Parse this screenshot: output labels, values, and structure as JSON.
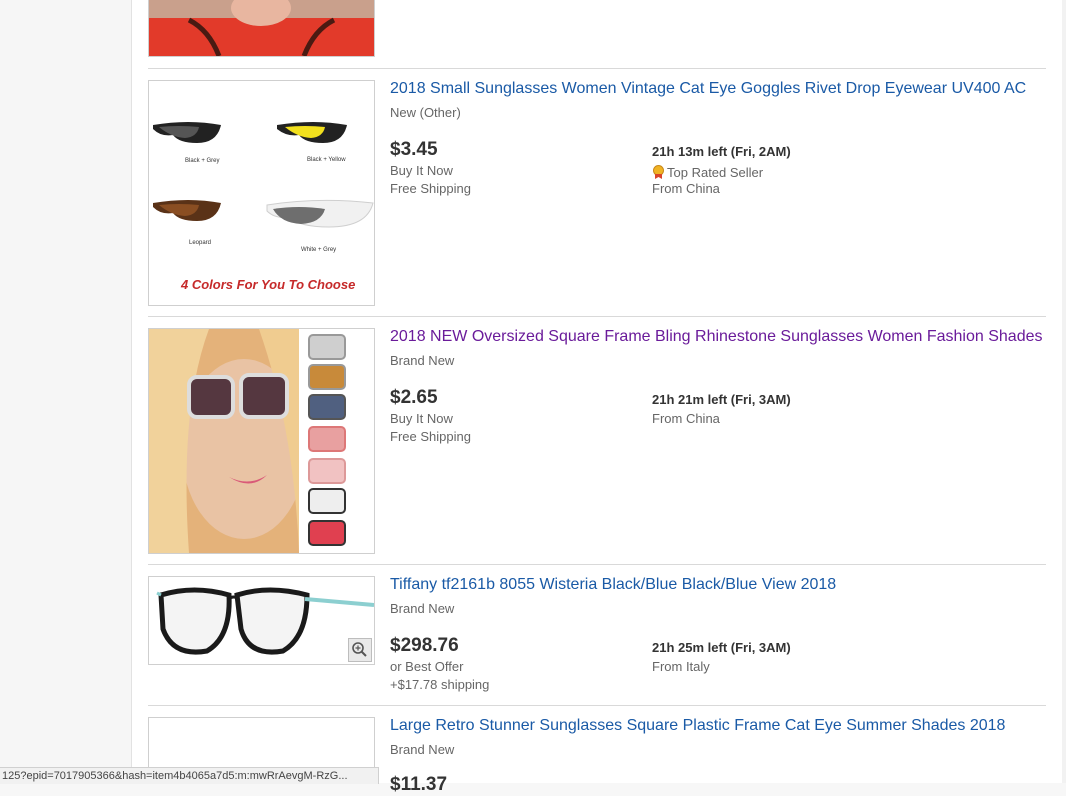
{
  "listings": [
    {
      "title": "2018 Small Sunglasses Women Vintage Cat Eye Goggles Rivet Drop Eyewear UV400 AC",
      "condition": "New (Other)",
      "price": "$3.45",
      "buy_format": "Buy It Now",
      "shipping": "Free Shipping",
      "time_left": "21h 13m left (Fri, 2AM)",
      "badge": "Top Rated Seller",
      "location": "From China",
      "image_labels": [
        "Black + Grey",
        "Black + Yellow",
        "Leopard",
        "White + Grey"
      ],
      "image_caption": "4 Colors For You To Choose"
    },
    {
      "title": "2018 NEW Oversized Square Frame Bling Rhinestone Sunglasses Women Fashion Shades",
      "condition": "Brand New",
      "price": "$2.65",
      "buy_format": "Buy It Now",
      "shipping": "Free Shipping",
      "time_left": "21h 21m left (Fri, 3AM)",
      "location": "From China"
    },
    {
      "title": "Tiffany tf2161b 8055 Wisteria Black/Blue Black/Blue View 2018",
      "condition": "Brand New",
      "price": "$298.76",
      "buy_format": "or Best Offer",
      "shipping": "+$17.78 shipping",
      "time_left": "21h 25m left (Fri, 3AM)",
      "location": "From Italy"
    },
    {
      "title": "Large Retro Stunner Sunglasses Square Plastic Frame Cat Eye Summer Shades 2018",
      "condition": "Brand New",
      "price": "$11.37"
    }
  ],
  "status_bar": "125?epid=7017905366&hash=item4b4065a7d5:m:mwRrAevgM-RzG..."
}
